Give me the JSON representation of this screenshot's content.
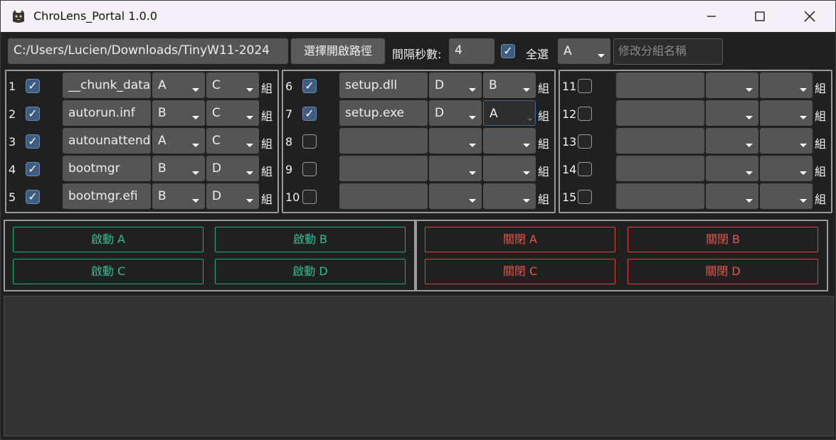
{
  "window": {
    "title": "ChroLens_Portal 1.0.0"
  },
  "toolbar": {
    "path_value": "C:/Users/Lucien/Downloads/TinyW11-2024",
    "choose_path_label": "選擇開啟路徑",
    "interval_label": "間隔秒數:",
    "interval_value": "4",
    "select_all_checked": true,
    "select_all_label": "全選",
    "group_select_value": "A",
    "rename_group_placeholder": "修改分組名稱"
  },
  "rows": [
    {
      "num": "1",
      "checked": true,
      "name": "__chunk_data",
      "g1": "A",
      "g2": "C",
      "suffix": "組"
    },
    {
      "num": "2",
      "checked": true,
      "name": "autorun.inf",
      "g1": "B",
      "g2": "C",
      "suffix": "組"
    },
    {
      "num": "3",
      "checked": true,
      "name": "autounattend",
      "g1": "A",
      "g2": "C",
      "suffix": "組"
    },
    {
      "num": "4",
      "checked": true,
      "name": "bootmgr",
      "g1": "B",
      "g2": "D",
      "suffix": "組"
    },
    {
      "num": "5",
      "checked": true,
      "name": "bootmgr.efi",
      "g1": "B",
      "g2": "D",
      "suffix": "組"
    },
    {
      "num": "6",
      "checked": true,
      "name": "setup.dll",
      "g1": "D",
      "g2": "B",
      "suffix": "組"
    },
    {
      "num": "7",
      "checked": true,
      "name": "setup.exe",
      "g1": "D",
      "g2": "A",
      "suffix": "組"
    },
    {
      "num": "8",
      "checked": false,
      "name": "",
      "g1": "",
      "g2": "",
      "suffix": "組"
    },
    {
      "num": "9",
      "checked": false,
      "name": "",
      "g1": "",
      "g2": "",
      "suffix": "組"
    },
    {
      "num": "10",
      "checked": false,
      "name": "",
      "g1": "",
      "g2": "",
      "suffix": "組"
    },
    {
      "num": "11",
      "checked": false,
      "name": "",
      "g1": "",
      "g2": "",
      "suffix": "組"
    },
    {
      "num": "12",
      "checked": false,
      "name": "",
      "g1": "",
      "g2": "",
      "suffix": "組"
    },
    {
      "num": "13",
      "checked": false,
      "name": "",
      "g1": "",
      "g2": "",
      "suffix": "組"
    },
    {
      "num": "14",
      "checked": false,
      "name": "",
      "g1": "",
      "g2": "",
      "suffix": "組"
    },
    {
      "num": "15",
      "checked": false,
      "name": "",
      "g1": "",
      "g2": "",
      "suffix": "組"
    }
  ],
  "actions": {
    "start_a": "啟動 A",
    "start_b": "啟動 B",
    "start_c": "啟動 C",
    "start_d": "啟動 D",
    "close_a": "關閉 A",
    "close_b": "關閉 B",
    "close_c": "關閉 C",
    "close_d": "關閉 D"
  },
  "colors": {
    "start": "#2fbf96",
    "close": "#e5574c",
    "checkbox_on": "#3d5d80"
  }
}
